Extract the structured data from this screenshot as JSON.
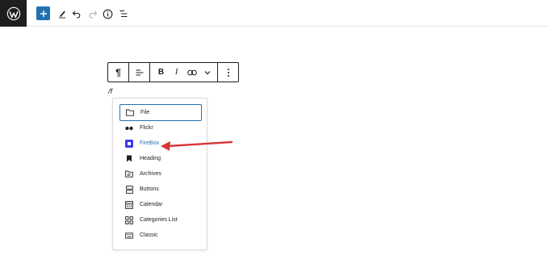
{
  "topbar": {
    "logo_icon": "wordpress-logo-icon",
    "tools": [
      {
        "name": "block-inserter",
        "icon": "plus-icon"
      },
      {
        "name": "tools",
        "icon": "pencil-icon"
      },
      {
        "name": "undo",
        "icon": "undo-icon"
      },
      {
        "name": "redo",
        "icon": "redo-icon"
      },
      {
        "name": "details",
        "icon": "info-icon"
      },
      {
        "name": "list-view",
        "icon": "list-view-icon"
      }
    ]
  },
  "block_toolbar": {
    "paragraph_glyph": "¶",
    "bold_label": "B",
    "italic_label": "I"
  },
  "editor": {
    "slash_text": "/f"
  },
  "autocomplete": {
    "items": [
      {
        "label": "File",
        "icon": "folder-icon",
        "selected": true
      },
      {
        "label": "Flickr",
        "icon": "flickr-icon",
        "selected": false
      },
      {
        "label": "FireBox",
        "icon": "firebox-icon",
        "selected": false
      },
      {
        "label": "Heading",
        "icon": "heading-bookmark-icon",
        "selected": false
      },
      {
        "label": "Archives",
        "icon": "archives-icon",
        "selected": false
      },
      {
        "label": "Buttons",
        "icon": "buttons-icon",
        "selected": false
      },
      {
        "label": "Calendar",
        "icon": "calendar-icon",
        "selected": false
      },
      {
        "label": "Categories List",
        "icon": "categories-icon",
        "selected": false
      },
      {
        "label": "Classic",
        "icon": "classic-keyboard-icon",
        "selected": false
      }
    ]
  },
  "colors": {
    "accent": "#2271b1",
    "dark": "#1e1e1e",
    "arrow": "#d63638",
    "firebox_icon": "#3a3aeb"
  }
}
